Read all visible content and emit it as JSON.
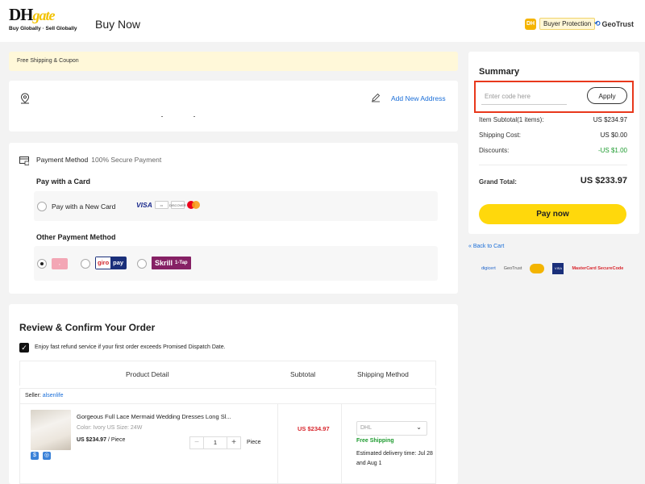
{
  "header": {
    "logo_main": "DH",
    "logo_gate": "gate",
    "logo_tagline": "Buy Globally · Sell Globally",
    "page_title": "Buy Now",
    "buyer_protection": "Buyer Protection",
    "geotrust": "GeoTrust"
  },
  "shipping_bar": {
    "text": "Free Shipping & Coupon"
  },
  "address": {
    "add_label": "Add New Address"
  },
  "payment": {
    "title": "Payment Method",
    "secure": "100% Secure Payment",
    "card_heading": "Pay with a Card",
    "new_card_label": "Pay with a New Card",
    "visa": "VISA",
    "discover": "DISCOVER",
    "other_heading": "Other Payment Method",
    "giro": "giro",
    "pay": "pay",
    "skrill": "Skrill",
    "skrill_tap": "1-Tap"
  },
  "review": {
    "title": "Review & Confirm Your Order",
    "refund_text": "Enjoy fast refund service if your first order exceeds Promised Dispatch Date.",
    "col_product": "Product Detail",
    "col_subtotal": "Subtotal",
    "col_shipping": "Shipping Method",
    "seller_label": "Seller:",
    "seller_name": "alsenlife",
    "product": {
      "title": "Gorgeous Full Lace Mermaid Wedding Dresses Long Sl...",
      "variant": "Color: Ivory  US Size: 24W",
      "price": "US $234.97",
      "price_unit": "/ Piece",
      "quantity": "1",
      "unit": "Piece",
      "subtotal": "US $234.97",
      "shipping_method": "DHL",
      "free_shipping": "Free Shipping",
      "delivery": "Estimated delivery time: Jul 28 and Aug 1"
    }
  },
  "summary": {
    "title": "Summary",
    "coupon_placeholder": "Enter code here",
    "apply_label": "Apply",
    "item_subtotal_label": "Item Subtotal(1 items):",
    "item_subtotal_value": "US $234.97",
    "shipping_label": "Shipping Cost:",
    "shipping_value": "US $0.00",
    "discount_label": "Discounts:",
    "discount_value": "-US $1.00",
    "grand_label": "Grand Total:",
    "grand_value": "US $233.97",
    "pay_now_label": "Pay now",
    "back_label": "« Back to Cart"
  },
  "trust": {
    "digicert": "digicert",
    "geotrust": "GeoTrust",
    "visa": "VISA",
    "mastercard": "MasterCard SecureCode"
  },
  "colors": {
    "accent_yellow": "#ffd80c",
    "link_blue": "#1a6ed8",
    "price_red": "#d8262d",
    "green": "#1e9b2f",
    "highlight": "#e8381c"
  }
}
